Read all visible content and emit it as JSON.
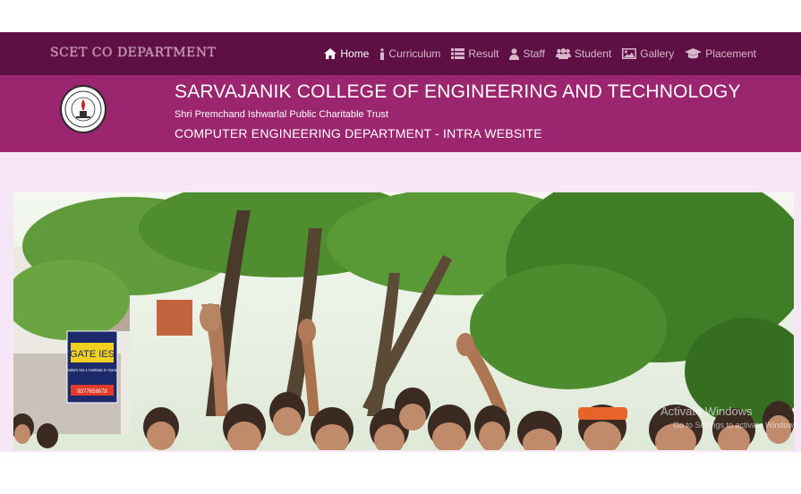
{
  "navbar": {
    "brand": "SCET CO DEPARTMENT",
    "links": [
      {
        "label": "Home",
        "icon": "home-icon"
      },
      {
        "label": "Curriculum",
        "icon": "info-icon"
      },
      {
        "label": "Result",
        "icon": "list-icon"
      },
      {
        "label": "Staff",
        "icon": "user-icon"
      },
      {
        "label": "Student",
        "icon": "users-icon"
      },
      {
        "label": "Gallery",
        "icon": "picture-icon"
      },
      {
        "label": "Placement",
        "icon": "graduation-cap-icon"
      }
    ],
    "active": "Home"
  },
  "header": {
    "title": "SARVAJANIK COLLEGE OF ENGINEERING AND TECHNOLOGY",
    "trust": "Shri Premchand Ishwarlal Public Charitable Trust",
    "department": "COMPUTER ENGINEERING DEPARTMENT - INTRA WEBSITE"
  },
  "slideshow": {
    "sign_text": "GATE IES",
    "sign_sub": "India's No.1 Institute in Surat",
    "sign_phone": "9377659678"
  },
  "windows_watermark": {
    "title": "Activate Windows",
    "subtitle": "Go to Settings to activate Windows."
  },
  "colors": {
    "navbar": "#5e0f43",
    "banner": "#9b256f",
    "content_bg": "#f7e6f6"
  }
}
